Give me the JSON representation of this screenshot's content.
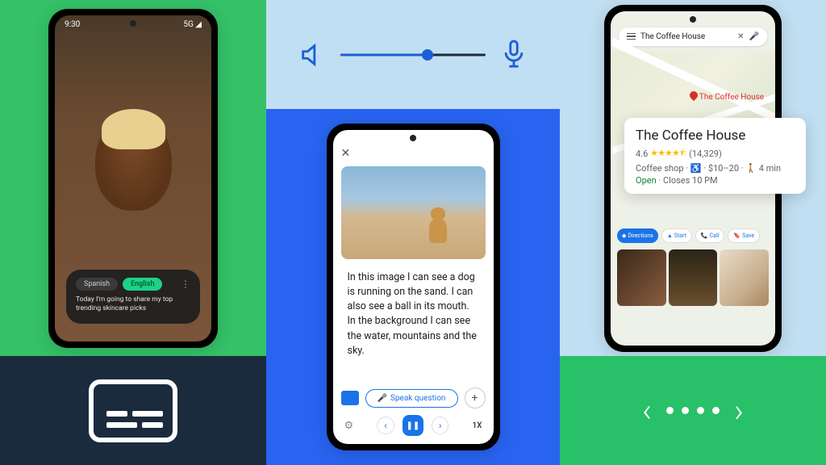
{
  "left_phone": {
    "status_time": "9:30",
    "status_signal": "5G ◢",
    "lang_from": "Spanish",
    "lang_to": "English",
    "caption": "Today I'm going to share my top trending skincare picks"
  },
  "volume": {
    "percent": 60
  },
  "lookout": {
    "description": "In this image I can see a dog is running on the sand. I can also see a ball in its mouth. In the background I can see the water, mountains and the sky.",
    "speak_label": "Speak question",
    "zoom": "1X"
  },
  "maps": {
    "search_value": "The Coffee House",
    "pin_label": "The Coffee House",
    "title": "The Coffee House",
    "rating": "4.6",
    "stars": "★★★★⯪",
    "reviews": "(14,329)",
    "category": "Coffee shop",
    "price_accessibility": "♿ · $10–20 · 🚶 4 min",
    "status_open": "Open",
    "status_closes": " · Closes 10 PM",
    "actions": {
      "directions": "Directions",
      "start": "Start",
      "call": "Call",
      "save": "Save"
    }
  },
  "colors": {
    "green": "#34c168",
    "lightblue": "#c1dff2",
    "navy": "#1a2b3d",
    "blue": "#2864f0"
  }
}
